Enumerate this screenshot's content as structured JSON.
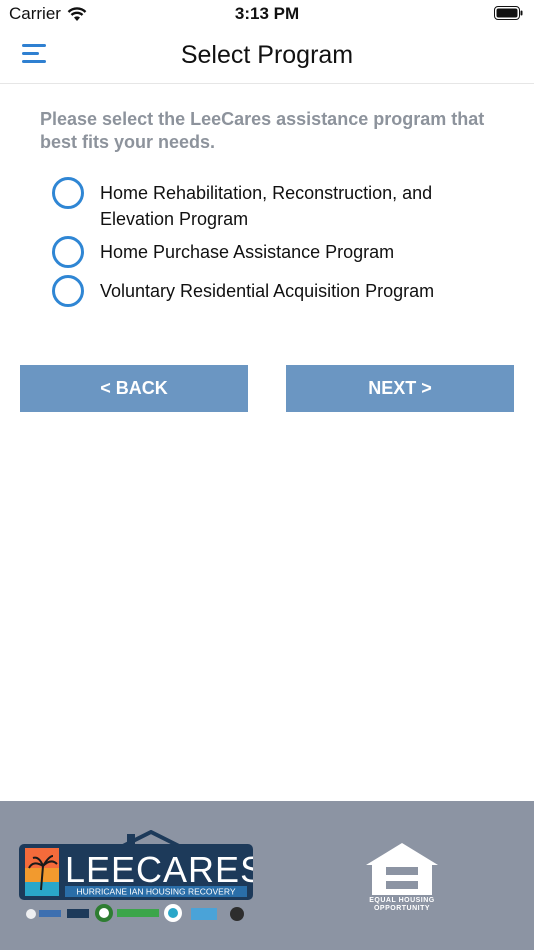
{
  "status": {
    "carrier": "Carrier",
    "time": "3:13 PM"
  },
  "nav": {
    "title": "Select Program"
  },
  "prompt": "Please select the LeeCares assistance program that best fits your needs.",
  "options": [
    {
      "label": "Home Rehabilitation, Reconstruction, and Elevation Program",
      "selected": false
    },
    {
      "label": "Home Purchase Assistance Program",
      "selected": false
    },
    {
      "label": "Voluntary Residential Acquisition Program",
      "selected": false
    }
  ],
  "buttons": {
    "back": "< BACK",
    "next": "NEXT >"
  },
  "footer": {
    "logo_name": "LEECARES",
    "logo_tagline": "HURRICANE IAN HOUSING RECOVERY",
    "eho_line1": "EQUAL HOUSING",
    "eho_line2": "OPPORTUNITY"
  },
  "colors": {
    "accent": "#2f86d4",
    "button": "#6b96c2",
    "footer": "#8c94a3",
    "prompt": "#8d939c"
  }
}
